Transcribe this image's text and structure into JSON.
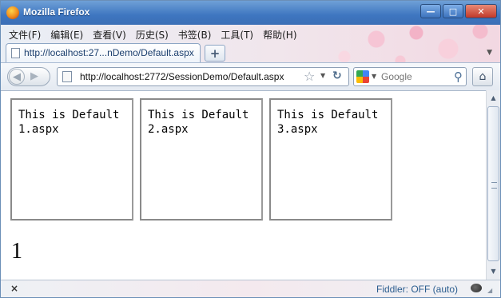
{
  "window": {
    "title": "Mozilla Firefox",
    "buttons": {
      "minimize": "—",
      "maximize": "□",
      "close": "✕"
    }
  },
  "menubar": [
    "文件(F)",
    "编辑(E)",
    "查看(V)",
    "历史(S)",
    "书签(B)",
    "工具(T)",
    "帮助(H)"
  ],
  "tab": {
    "title": "http://localhost:27...nDemo/Default.aspx",
    "new_tab_label": "+"
  },
  "navbar": {
    "url": "http://localhost:2772/SessionDemo/Default.aspx",
    "search_placeholder": "Google"
  },
  "content": {
    "panels": [
      "This is Default1.aspx",
      "This is Default2.aspx",
      "This is Default3.aspx"
    ],
    "counter": "1"
  },
  "statusbar": {
    "fiddler": "Fiddler: OFF (auto)"
  },
  "icons": {
    "back": "back-arrow-icon",
    "forward": "forward-arrow-icon",
    "star": "bookmark-star-icon",
    "reload": "reload-icon",
    "search": "magnifier-icon",
    "home": "home-icon"
  }
}
